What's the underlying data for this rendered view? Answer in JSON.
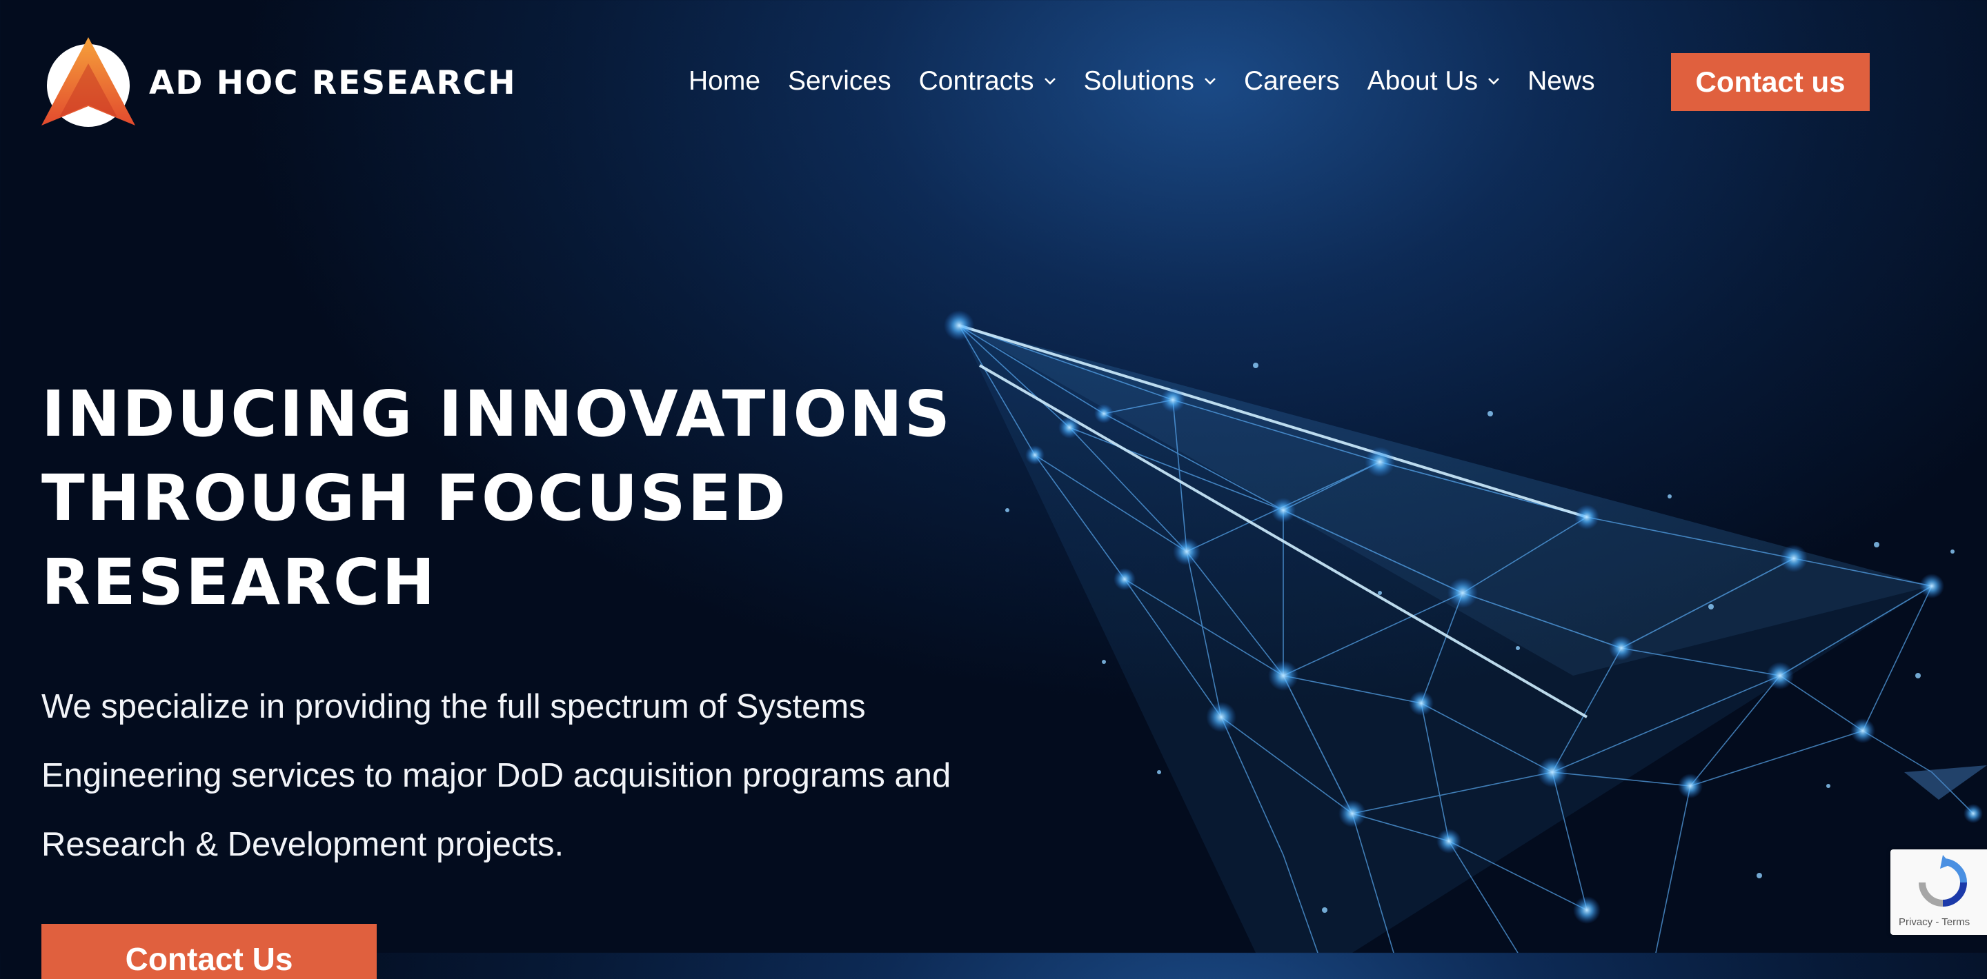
{
  "brand": {
    "name": "AD HOC RESEARCH",
    "accent": "#e0603e"
  },
  "nav": {
    "items": [
      {
        "label": "Home",
        "dropdown": false
      },
      {
        "label": "Services",
        "dropdown": false
      },
      {
        "label": "Contracts",
        "dropdown": true
      },
      {
        "label": "Solutions",
        "dropdown": true
      },
      {
        "label": "Careers",
        "dropdown": false
      },
      {
        "label": "About Us",
        "dropdown": true
      },
      {
        "label": "News",
        "dropdown": false
      }
    ],
    "cta_label": "Contact us"
  },
  "hero": {
    "title_lines": [
      "INDUCING INNOVATIONS",
      "THROUGH FOCUSED",
      "RESEARCH"
    ],
    "description": "We specialize in providing the full spectrum of Systems Engineering services to major DoD acquisition programs and Research & Development projects.",
    "button_label": "Contact Us"
  },
  "recaptcha": {
    "links": "Privacy - Terms"
  },
  "icons": {
    "dropdown": "chevron-down-icon",
    "logo": "ad-hoc-logo-icon",
    "hero_art": "paper-plane-network-icon",
    "recaptcha": "recaptcha-icon"
  }
}
